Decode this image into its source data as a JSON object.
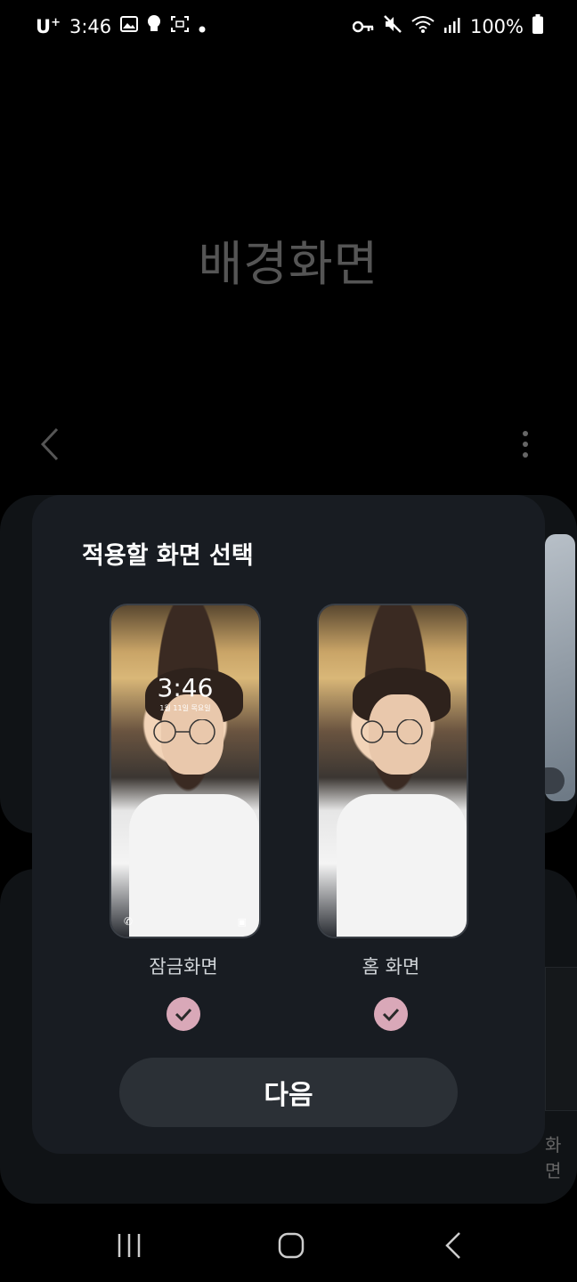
{
  "status_bar": {
    "carrier": "U",
    "carrier_sup": "+",
    "time": "3:46",
    "battery": "100%"
  },
  "background": {
    "title": "배경화면",
    "partial_label": "화면"
  },
  "dialog": {
    "title": "적용할 화면 선택",
    "lock_screen": {
      "label": "잠금화면",
      "time": "3:46",
      "date": "1월 11일 목요일",
      "checked": true
    },
    "home_screen": {
      "label": "홈 화면",
      "checked": true
    },
    "next_button": "다음"
  },
  "colors": {
    "dialog_bg": "#181c22",
    "check_bg": "#d9a8b8",
    "button_bg": "#2b3036"
  }
}
